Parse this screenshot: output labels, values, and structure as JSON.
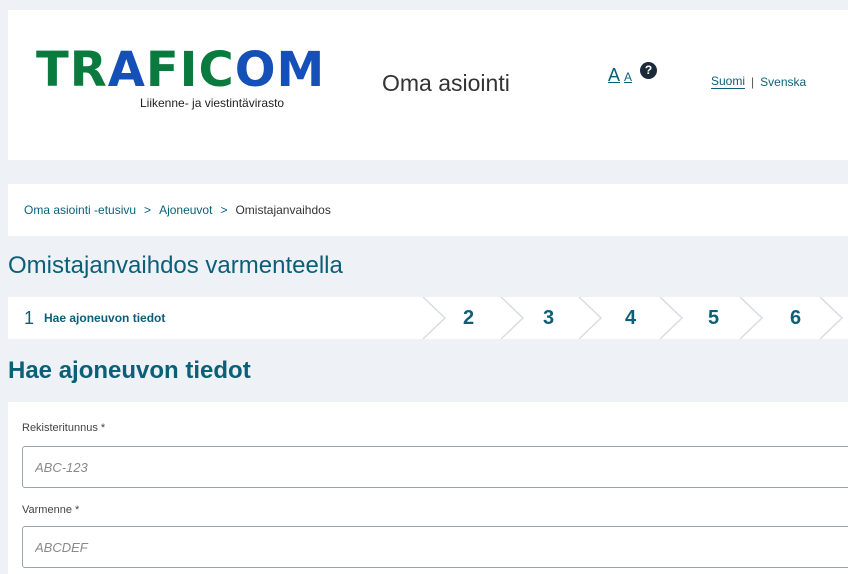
{
  "header": {
    "logo_text_green_1": "TR",
    "logo_text_blue": "A",
    "logo_text_green_2": "FIC",
    "logo_text_blue_2": "O",
    "logo_text_green_3": "M",
    "logo_subtitle": "Liikenne- ja viestintävirasto",
    "app_name": "Oma asiointi",
    "font_large_label": "A",
    "font_small_label": "A",
    "help_label": "?",
    "languages": {
      "fi": "Suomi",
      "separator": "|",
      "sv": "Svenska"
    }
  },
  "breadcrumb": {
    "items": [
      "Oma asiointi -etusivu",
      "Ajoneuvot",
      "Omistajanvaihdos"
    ],
    "separator": ">"
  },
  "page_title": "Omistajanvaihdos varmenteella",
  "steps": {
    "current": {
      "number": "1",
      "label": "Hae ajoneuvon tiedot"
    },
    "others": [
      "2",
      "3",
      "4",
      "5",
      "6"
    ]
  },
  "section_title": "Hae ajoneuvon tiedot",
  "form": {
    "registration": {
      "label": "Rekisteritunnus *",
      "placeholder": "ABC-123"
    },
    "certificate": {
      "label": "Varmenne *",
      "placeholder": "ABCDEF"
    }
  },
  "colors": {
    "brand_green": "#0b7a3e",
    "brand_blue": "#1550b8",
    "link_teal": "#0b5f77",
    "page_bg": "#eef1f5"
  }
}
